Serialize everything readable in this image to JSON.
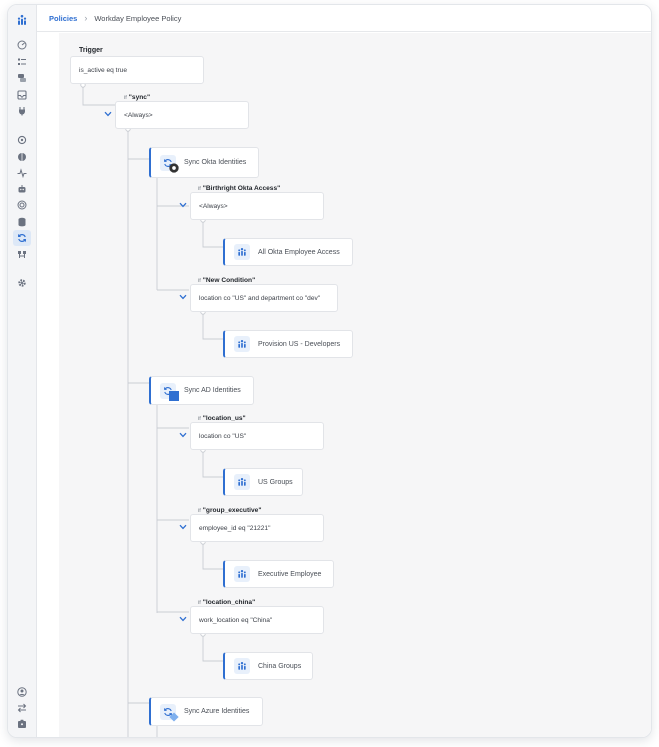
{
  "colors": {
    "accent": "#2f6fd1",
    "sidebar_bg": "#f4f5f7",
    "canvas_bg": "#f6f6f7",
    "connector": "#c9cdd3"
  },
  "breadcrumb": {
    "root": "Policies",
    "current": "Workday Employee Policy"
  },
  "sidebar": {
    "top_icons": [
      "logo-icon",
      "dashboard-icon",
      "list-icon",
      "chat-icon",
      "inbox-icon",
      "plug-icon"
    ],
    "mid_icons": [
      "puzzle-icon",
      "globe-icon",
      "activity-icon",
      "bot-icon",
      "target-icon",
      "database-icon",
      "sync-icon",
      "flow-icon",
      "settings-icon"
    ],
    "bottom_icons": [
      "user-icon",
      "swap-icon",
      "badge-icon"
    ],
    "active": "sync-icon"
  },
  "tree": {
    "trigger": {
      "title": "Trigger",
      "condition": "is_active eq true"
    },
    "root_condition": {
      "if": "if",
      "name": "\"sync\"",
      "value": "<Always>"
    },
    "actions": [
      {
        "label": "Sync Okta Identities",
        "icon": "sync-icon",
        "conditions": [
          {
            "if": "if",
            "name": "\"Birthright Okta Access\"",
            "value": "<Always>",
            "group": "All Okta Employee Access"
          },
          {
            "if": "if",
            "name": "\"New Condition\"",
            "value": "location co \"US\" and department co \"dev\"",
            "group": "Provision US - Developers"
          }
        ]
      },
      {
        "label": "Sync AD Identities",
        "icon": "sync-icon",
        "conditions": [
          {
            "if": "if",
            "name": "\"location_us\"",
            "value": "location co \"US\"",
            "group": "US Groups"
          },
          {
            "if": "if",
            "name": "\"group_executive\"",
            "value": "employee_id eq \"21221\"",
            "group": "Executive Employee"
          },
          {
            "if": "if",
            "name": "\"location_china\"",
            "value": "work_location eq \"China\"",
            "group": "China Groups"
          }
        ]
      },
      {
        "label": "Sync Azure Identities",
        "icon": "sync-icon",
        "conditions": []
      }
    ]
  }
}
